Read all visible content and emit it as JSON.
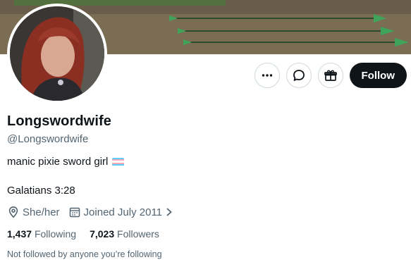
{
  "banner": {
    "description_icon": "arrows-banner-image"
  },
  "profile": {
    "display_name": "Longswordwife",
    "handle": "@Longswordwife",
    "bio_line1": "manic pixie sword girl",
    "bio_flag": "transgender-flag-emoji",
    "bio_line2": "Galatians 3:28",
    "location": "She/her",
    "joined": "Joined July 2011"
  },
  "actions": {
    "more_icon": "more-icon",
    "message_icon": "message-icon",
    "gift_icon": "gift-icon",
    "follow_label": "Follow"
  },
  "stats": {
    "following_count": "1,437",
    "following_label": "Following",
    "followers_count": "7,023",
    "followers_label": "Followers"
  },
  "notice": "Not followed by anyone you’re following",
  "colors": {
    "text_primary": "#0f1419",
    "text_secondary": "#536471",
    "follow_bg": "#0f1419",
    "border": "#cfd9de"
  }
}
